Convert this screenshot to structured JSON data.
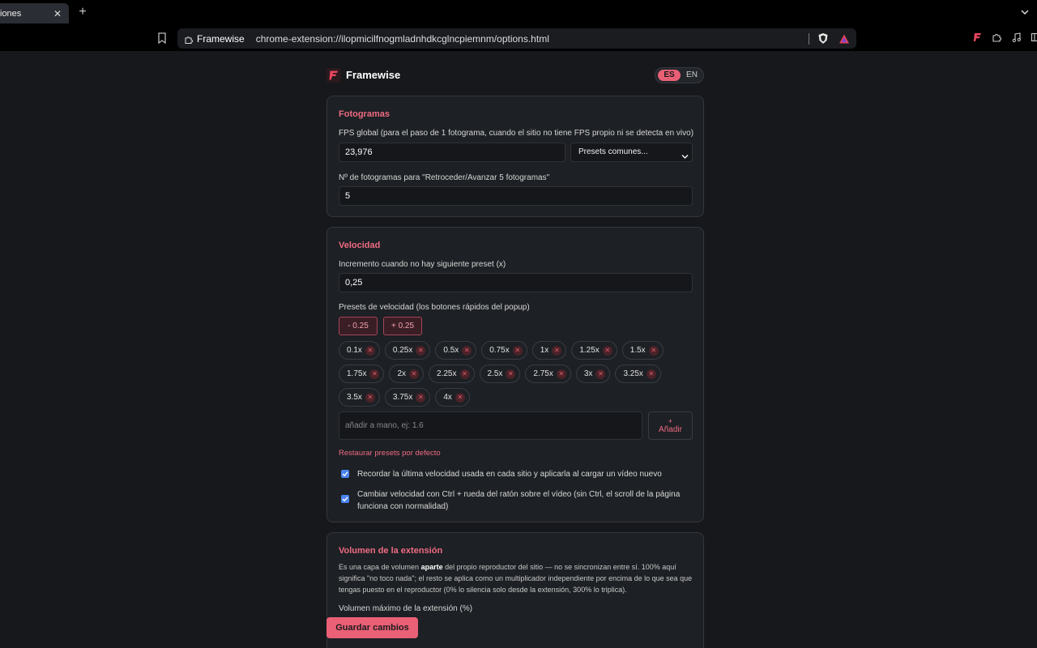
{
  "browser": {
    "tab_title": "iones",
    "tab_close": "✕",
    "new_tab": "+",
    "site_chip": "Framewise",
    "url": "chrome-extension://ilopmicilfnogmladnhdkcglncpiemnm/options.html"
  },
  "header": {
    "title": "Framewise",
    "lang_es": "ES",
    "lang_en": "EN"
  },
  "frames": {
    "title": "Fotogramas",
    "fps_label": "FPS global (para el paso de 1 fotograma, cuando el sitio no tiene FPS propio ni se detecta en vivo)",
    "fps_value": "23,976",
    "presets_select": "Presets comunes...",
    "step_label": "Nº de fotogramas para \"Retroceder/Avanzar 5 fotogramas\"",
    "step_value": "5"
  },
  "speed": {
    "title": "Velocidad",
    "increment_label": "Incremento cuando no hay siguiente preset (x)",
    "increment_value": "0,25",
    "presets_label": "Presets de velocidad (los botones rápidos del popup)",
    "minus_btn": "- 0.25",
    "plus_btn": "+ 0.25",
    "presets": [
      "0.1x",
      "0.25x",
      "0.5x",
      "0.75x",
      "1x",
      "1.25x",
      "1.5x",
      "1.75x",
      "2x",
      "2.25x",
      "2.5x",
      "2.75x",
      "3x",
      "3.25x",
      "3.5x",
      "3.75x",
      "4x"
    ],
    "add_placeholder": "añadir a mano, ej: 1.6",
    "add_plus": "+",
    "add_label": "Añadir",
    "restore": "Restaurar presets por defecto",
    "remember_label": "Recordar la última velocidad usada en cada sitio y aplicarla al cargar un vídeo nuevo",
    "remember_checked": true,
    "wheel_label": "Cambiar velocidad con Ctrl + rueda del ratón sobre el vídeo (sin Ctrl, el scroll de la página funciona con normalidad)",
    "wheel_checked": true
  },
  "volume": {
    "title": "Volumen de la extensión",
    "desc_pre": "Es una capa de volumen ",
    "desc_bold": "aparte",
    "desc_post": " del propio reproductor del sitio — no se sincronizan entre sí. 100% aquí significa \"no toco nada\"; el resto se aplica como un multiplicador independiente por encima de lo que sea que tengas puesto en el reproductor (0% lo silencia solo desde la extensión, 300% lo triplica).",
    "max_label": "Volumen máximo de la extensión (%)"
  },
  "footer": {
    "save": "Guardar cambios"
  },
  "colors": {
    "accent": "#ef6b83",
    "background": "#16181c",
    "card": "#1d2024"
  }
}
